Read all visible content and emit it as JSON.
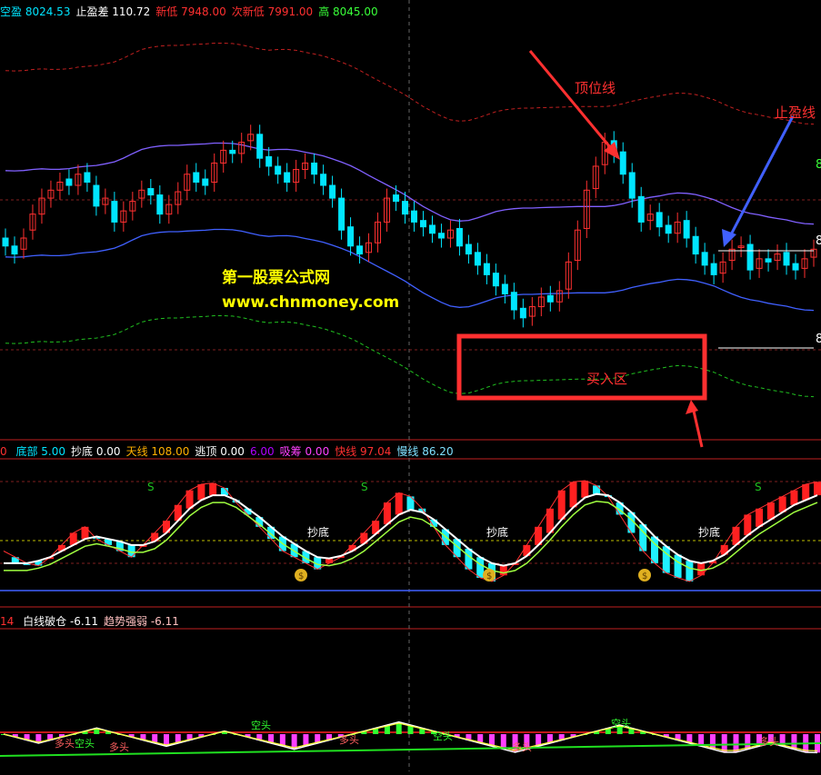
{
  "header_main": {
    "items": [
      {
        "label": "空盈",
        "value": "8024.53",
        "label_color": "#00e5ff",
        "value_color": "#00e5ff"
      },
      {
        "label": "止盈差",
        "value": "110.72",
        "label_color": "#ffffff",
        "value_color": "#ffffff"
      },
      {
        "label": "新低",
        "value": "7948.00",
        "label_color": "#ff3030",
        "value_color": "#ff3030"
      },
      {
        "label": "次新低",
        "value": "7991.00",
        "label_color": "#ff3030",
        "value_color": "#ff3030"
      },
      {
        "label": "高",
        "value": "8045.00",
        "label_color": "#39ff39",
        "value_color": "#39ff39"
      }
    ]
  },
  "header_mid": {
    "lead": "0",
    "items": [
      {
        "label": "底部",
        "value": "5.00",
        "color": "#00e5ff"
      },
      {
        "label": "抄底",
        "value": "0.00",
        "color": "#ffffff"
      },
      {
        "label": "天线",
        "value": "108.00",
        "color": "#ffb000"
      },
      {
        "label": "逃顶",
        "value": "0.00",
        "color": "#ffffff"
      },
      {
        "label": "",
        "value": "6.00",
        "color": "#b000ff"
      },
      {
        "label": "吸筹",
        "value": "0.00",
        "color": "#ff40ff"
      },
      {
        "label": "快线",
        "value": "97.04",
        "color": "#ff3030"
      },
      {
        "label": "慢线",
        "value": "86.20",
        "color": "#7fe0ff"
      }
    ]
  },
  "header_bottom": {
    "lead": "14",
    "items": [
      {
        "label": "白线破仓",
        "value": "-6.11",
        "color": "#ffffff"
      },
      {
        "label": "趋势强弱",
        "value": "-6.11",
        "color": "#ffc0c0"
      }
    ]
  },
  "annotations": {
    "top_line_label": "顶位线",
    "take_profit_label": "止盈线",
    "buy_zone_label": "买入区",
    "watermark_title": "第一股票公式网",
    "watermark_url": "www.chnmoney.com",
    "right_axis_labels": [
      "8",
      "8",
      "8"
    ],
    "bottom_signal_label": "抄底",
    "sell_signal_label": "S",
    "gold_signal_label": "$",
    "duokong_labels": [
      "多头",
      "空头"
    ]
  },
  "colors": {
    "background": "#000000",
    "up_candle": "#ff3030",
    "down_candle": "#00e5ff",
    "upper_band": "#c02020",
    "mid_line": "#8060ff",
    "lower_line": "#4060ff",
    "green_band": "#20c020",
    "annotation_red": "#ff3030",
    "arrow_blue": "#4060ff",
    "watermark_yellow": "#ffff00"
  },
  "chart_data": [
    {
      "type": "candlestick",
      "title": "",
      "ylim": [
        7900,
        8130
      ],
      "n_bars": 90,
      "close": [
        8010,
        8005,
        8015,
        8030,
        8040,
        8045,
        8050,
        8048,
        8055,
        8050,
        8035,
        8040,
        8025,
        8032,
        8038,
        8045,
        8042,
        8030,
        8036,
        8044,
        8055,
        8050,
        8048,
        8062,
        8070,
        8068,
        8075,
        8080,
        8065,
        8060,
        8055,
        8050,
        8058,
        8062,
        8055,
        8048,
        8040,
        8020,
        8010,
        8005,
        8012,
        8025,
        8040,
        8038,
        8030,
        8025,
        8022,
        8018,
        8015,
        8020,
        8010,
        8005,
        7998,
        7992,
        7985,
        7980,
        7970,
        7965,
        7972,
        7978,
        7975,
        7982,
        8000,
        8020,
        8045,
        8060,
        8075,
        8068,
        8055,
        8040,
        8025,
        8030,
        8022,
        8018,
        8025,
        8015,
        8005,
        7998,
        7992,
        8000,
        8008,
        8010,
        7995,
        8002,
        8000,
        8005,
        7998,
        7995,
        8002,
        8008
      ],
      "open": [
        8015,
        8010,
        8008,
        8020,
        8030,
        8040,
        8045,
        8052,
        8048,
        8056,
        8048,
        8036,
        8038,
        8025,
        8032,
        8040,
        8046,
        8042,
        8030,
        8036,
        8045,
        8056,
        8052,
        8050,
        8062,
        8070,
        8068,
        8076,
        8080,
        8066,
        8060,
        8056,
        8050,
        8058,
        8062,
        8055,
        8048,
        8040,
        8022,
        8010,
        8006,
        8012,
        8025,
        8042,
        8038,
        8032,
        8026,
        8023,
        8018,
        8015,
        8021,
        8011,
        8006,
        7999,
        7993,
        7986,
        7981,
        7971,
        7966,
        7972,
        7979,
        7975,
        7983,
        8001,
        8021,
        8046,
        8061,
        8076,
        8069,
        8056,
        8041,
        8026,
        8031,
        8023,
        8018,
        8026,
        8016,
        8006,
        7999,
        7993,
        8001,
        8009,
        8011,
        7996,
        8002,
        8001,
        8006,
        7999,
        7996,
        8003
      ],
      "overlays": [
        "upper band (dashed)",
        "mid line",
        "lower line",
        "green band (dashed)"
      ]
    },
    {
      "type": "indicator",
      "series": [
        {
          "name": "快线",
          "values": [
            40,
            35,
            30,
            28,
            35,
            45,
            55,
            60,
            50,
            45,
            40,
            35,
            45,
            55,
            65,
            78,
            90,
            95,
            96,
            92,
            80,
            70,
            60,
            50,
            40,
            35,
            30,
            25,
            30,
            35,
            45,
            55,
            65,
            80,
            88,
            85,
            75,
            60,
            45,
            35,
            25,
            18,
            15,
            20,
            30,
            45,
            60,
            75,
            90,
            97,
            98,
            94,
            85,
            70,
            55,
            40,
            30,
            22,
            18,
            15,
            20,
            30,
            45,
            60,
            70,
            75,
            80,
            85,
            90,
            95,
            97
          ]
        },
        {
          "name": "慢线",
          "values": [
            30,
            30,
            30,
            32,
            35,
            40,
            45,
            50,
            52,
            50,
            48,
            45,
            45,
            48,
            55,
            65,
            75,
            82,
            86,
            86,
            82,
            75,
            68,
            60,
            52,
            46,
            40,
            35,
            34,
            36,
            40,
            46,
            54,
            62,
            70,
            74,
            72,
            66,
            58,
            50,
            42,
            35,
            30,
            28,
            30,
            36,
            45,
            55,
            66,
            76,
            84,
            87,
            86,
            80,
            72,
            62,
            52,
            44,
            37,
            32,
            30,
            32,
            37,
            45,
            53,
            60,
            66,
            72,
            78,
            82,
            86
          ]
        }
      ],
      "ylim": [
        0,
        110
      ]
    },
    {
      "type": "indicator",
      "series": [
        {
          "name": "白线破仓",
          "values": [
            0,
            -1,
            -2,
            -3,
            -2,
            -1,
            0,
            1,
            2,
            1,
            0,
            -1,
            -2,
            -3,
            -4,
            -3,
            -2,
            -1,
            0,
            1,
            0,
            -1,
            -2,
            -3,
            -4,
            -5,
            -4,
            -3,
            -2,
            -1,
            0,
            1,
            2,
            3,
            4,
            3,
            2,
            1,
            0,
            -1,
            -2,
            -3,
            -4,
            -5,
            -6,
            -5,
            -4,
            -3,
            -2,
            -1,
            0,
            1,
            2,
            3,
            2,
            1,
            0,
            -1,
            -2,
            -3,
            -4,
            -5,
            -6,
            -6,
            -5,
            -4,
            -3,
            -4,
            -5,
            -6,
            -6.11
          ]
        },
        {
          "name": "趋势强弱",
          "values": [
            0,
            -1,
            -2,
            -3,
            -2,
            -1,
            0,
            1,
            2,
            1,
            0,
            -1,
            -2,
            -3,
            -4,
            -3,
            -2,
            -1,
            0,
            1,
            0,
            -1,
            -2,
            -3,
            -4,
            -5,
            -4,
            -3,
            -2,
            -1,
            0,
            1,
            2,
            3,
            4,
            3,
            2,
            1,
            0,
            -1,
            -2,
            -3,
            -4,
            -5,
            -6,
            -5,
            -4,
            -3,
            -2,
            -1,
            0,
            1,
            2,
            3,
            2,
            1,
            0,
            -1,
            -2,
            -3,
            -4,
            -5,
            -6,
            -6,
            -5,
            -4,
            -3,
            -4,
            -5,
            -6,
            -6.11
          ]
        }
      ],
      "ylim": [
        -12,
        12
      ]
    }
  ]
}
